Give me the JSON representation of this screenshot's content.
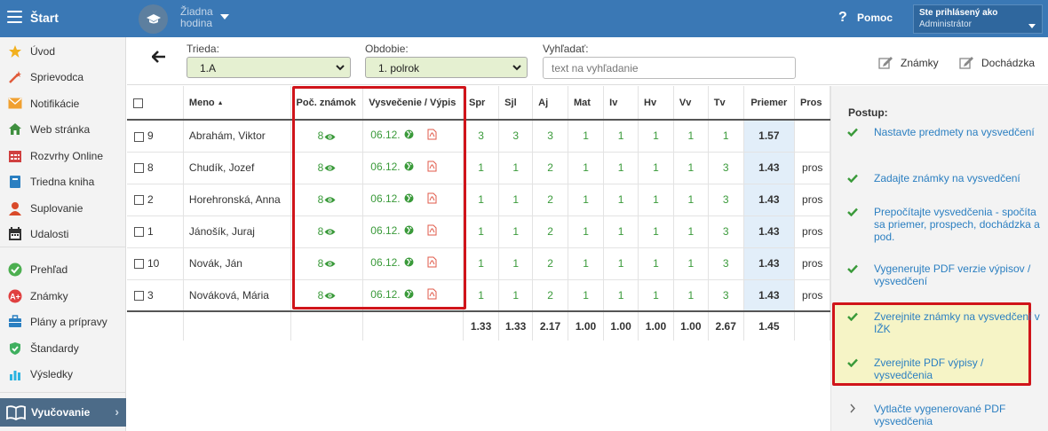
{
  "topbar": {
    "menu_label": "Štart",
    "lesson": "Žiadna hodina",
    "help": "Pomoc",
    "user_label": "Ste prihlásený ako",
    "user_name": "Administrátor"
  },
  "sidebar": {
    "items": [
      {
        "label": "Úvod",
        "icon": "star-icon",
        "color": "#f2b01e"
      },
      {
        "label": "Sprievodca",
        "icon": "wand-icon",
        "color": "#e05a3a"
      },
      {
        "label": "Notifikácie",
        "icon": "envelope-icon",
        "color": "#f0a030"
      },
      {
        "label": "Web stránka",
        "icon": "home-icon",
        "color": "#3f8f3f"
      },
      {
        "label": "Rozvrhy Online",
        "icon": "calendar-icon",
        "color": "#d04040"
      },
      {
        "label": "Triedna kniha",
        "icon": "book-icon",
        "color": "#2b7fc1"
      },
      {
        "label": "Suplovanie",
        "icon": "person-icon",
        "color": "#d94a2a"
      },
      {
        "label": "Udalosti",
        "icon": "calendar-dark-icon",
        "color": "#333333"
      },
      {
        "label": "Prehľad",
        "icon": "check-circle-icon",
        "color": "#4caf50"
      },
      {
        "label": "Známky",
        "icon": "grade-icon",
        "color": "#e04040"
      },
      {
        "label": "Plány a prípravy",
        "icon": "briefcase-icon",
        "color": "#2b7fc1"
      },
      {
        "label": "Štandardy",
        "icon": "shield-icon",
        "color": "#3faf5f"
      },
      {
        "label": "Výsledky",
        "icon": "barchart-icon",
        "color": "#2bb3e0"
      }
    ],
    "active": "Vyučovanie"
  },
  "filters": {
    "class_label": "Trieda:",
    "class_value": "1.A",
    "period_label": "Obdobie:",
    "period_value": "1. polrok",
    "search_label": "Vyhľadať:",
    "search_placeholder": "text na vyhľadanie",
    "grades_tool": "Známky",
    "attendance_tool": "Dochádzka"
  },
  "table": {
    "headers": {
      "name": "Meno",
      "count": "Poč. známok",
      "cert": "Vysvečenie / Výpis",
      "subjects": [
        "Spr",
        "Sjl",
        "Aj",
        "Mat",
        "Iv",
        "Hv",
        "Vv",
        "Tv"
      ],
      "avg": "Priemer",
      "pros": "Pros"
    },
    "rows": [
      {
        "num": "9",
        "name": "Abrahám, Viktor",
        "count": "8",
        "date": "06.12.",
        "grades": [
          "3",
          "3",
          "3",
          "1",
          "1",
          "1",
          "1",
          "1"
        ],
        "avg": "1.57",
        "pros": ""
      },
      {
        "num": "8",
        "name": "Chudík, Jozef",
        "count": "8",
        "date": "06.12.",
        "grades": [
          "1",
          "1",
          "2",
          "1",
          "1",
          "1",
          "1",
          "3"
        ],
        "avg": "1.43",
        "pros": "pros"
      },
      {
        "num": "2",
        "name": "Horehronská, Anna",
        "count": "8",
        "date": "06.12.",
        "grades": [
          "1",
          "1",
          "2",
          "1",
          "1",
          "1",
          "1",
          "3"
        ],
        "avg": "1.43",
        "pros": "pros"
      },
      {
        "num": "1",
        "name": "Jánošík, Juraj",
        "count": "8",
        "date": "06.12.",
        "grades": [
          "1",
          "1",
          "2",
          "1",
          "1",
          "1",
          "1",
          "3"
        ],
        "avg": "1.43",
        "pros": "pros"
      },
      {
        "num": "10",
        "name": "Novák, Ján",
        "count": "8",
        "date": "06.12.",
        "grades": [
          "1",
          "1",
          "2",
          "1",
          "1",
          "1",
          "1",
          "3"
        ],
        "avg": "1.43",
        "pros": "pros"
      },
      {
        "num": "3",
        "name": "Nováková, Mária",
        "count": "8",
        "date": "06.12.",
        "grades": [
          "1",
          "1",
          "2",
          "1",
          "1",
          "1",
          "1",
          "3"
        ],
        "avg": "1.43",
        "pros": "pros"
      }
    ],
    "totals": [
      "1.33",
      "1.33",
      "2.17",
      "1.00",
      "1.00",
      "1.00",
      "1.00",
      "2.67"
    ],
    "total_avg": "1.45"
  },
  "panel": {
    "title": "Postup:",
    "steps": [
      "Nastavte predmety na vysvedčení",
      "Zadajte známky na vysvedčení",
      "Prepočítajte vysvedčenia - spočíta sa priemer, prospech, dochádzka a pod.",
      "Vygenerujte PDF verzie výpisov / vysvedčení",
      "Zverejnite známky na vysvedčení v IŽK",
      "Zverejnite PDF výpisy / vysvedčenia",
      "Vytlačte vygenerované PDF vysvedčenia"
    ]
  },
  "colors": {
    "topbar": "#3a78b5",
    "grade_green": "#3a9a3a",
    "highlight_red": "#d0141a",
    "link_blue": "#2b7fc1"
  }
}
